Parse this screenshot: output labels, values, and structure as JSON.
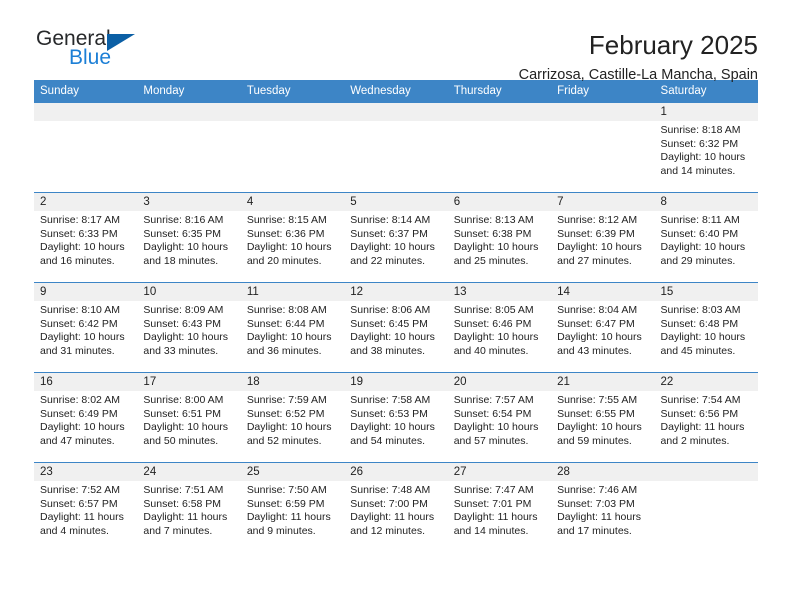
{
  "logo": {
    "text_primary": "General",
    "text_secondary": "Blue",
    "triangle_icon": "triangle-icon",
    "color_primary": "#27292b",
    "color_secondary": "#1c7fd6",
    "color_triangle": "#0b5fa5"
  },
  "header": {
    "title": "February 2025",
    "subtitle": "Carrizosa, Castille-La Mancha, Spain"
  },
  "theme": {
    "header_bg": "#3d85c6",
    "header_text": "#ffffff",
    "daynum_band_bg": "#f0f0f0",
    "cell_border": "#3d85c6",
    "body_text": "#222222"
  },
  "calendar": {
    "weekday_headers": [
      "Sunday",
      "Monday",
      "Tuesday",
      "Wednesday",
      "Thursday",
      "Friday",
      "Saturday"
    ],
    "weeks": [
      [
        {
          "day": "",
          "empty": true
        },
        {
          "day": "",
          "empty": true
        },
        {
          "day": "",
          "empty": true
        },
        {
          "day": "",
          "empty": true
        },
        {
          "day": "",
          "empty": true
        },
        {
          "day": "",
          "empty": true
        },
        {
          "day": "1",
          "sunrise": "Sunrise: 8:18 AM",
          "sunset": "Sunset: 6:32 PM",
          "daylight": "Daylight: 10 hours and 14 minutes."
        }
      ],
      [
        {
          "day": "2",
          "sunrise": "Sunrise: 8:17 AM",
          "sunset": "Sunset: 6:33 PM",
          "daylight": "Daylight: 10 hours and 16 minutes."
        },
        {
          "day": "3",
          "sunrise": "Sunrise: 8:16 AM",
          "sunset": "Sunset: 6:35 PM",
          "daylight": "Daylight: 10 hours and 18 minutes."
        },
        {
          "day": "4",
          "sunrise": "Sunrise: 8:15 AM",
          "sunset": "Sunset: 6:36 PM",
          "daylight": "Daylight: 10 hours and 20 minutes."
        },
        {
          "day": "5",
          "sunrise": "Sunrise: 8:14 AM",
          "sunset": "Sunset: 6:37 PM",
          "daylight": "Daylight: 10 hours and 22 minutes."
        },
        {
          "day": "6",
          "sunrise": "Sunrise: 8:13 AM",
          "sunset": "Sunset: 6:38 PM",
          "daylight": "Daylight: 10 hours and 25 minutes."
        },
        {
          "day": "7",
          "sunrise": "Sunrise: 8:12 AM",
          "sunset": "Sunset: 6:39 PM",
          "daylight": "Daylight: 10 hours and 27 minutes."
        },
        {
          "day": "8",
          "sunrise": "Sunrise: 8:11 AM",
          "sunset": "Sunset: 6:40 PM",
          "daylight": "Daylight: 10 hours and 29 minutes."
        }
      ],
      [
        {
          "day": "9",
          "sunrise": "Sunrise: 8:10 AM",
          "sunset": "Sunset: 6:42 PM",
          "daylight": "Daylight: 10 hours and 31 minutes."
        },
        {
          "day": "10",
          "sunrise": "Sunrise: 8:09 AM",
          "sunset": "Sunset: 6:43 PM",
          "daylight": "Daylight: 10 hours and 33 minutes."
        },
        {
          "day": "11",
          "sunrise": "Sunrise: 8:08 AM",
          "sunset": "Sunset: 6:44 PM",
          "daylight": "Daylight: 10 hours and 36 minutes."
        },
        {
          "day": "12",
          "sunrise": "Sunrise: 8:06 AM",
          "sunset": "Sunset: 6:45 PM",
          "daylight": "Daylight: 10 hours and 38 minutes."
        },
        {
          "day": "13",
          "sunrise": "Sunrise: 8:05 AM",
          "sunset": "Sunset: 6:46 PM",
          "daylight": "Daylight: 10 hours and 40 minutes."
        },
        {
          "day": "14",
          "sunrise": "Sunrise: 8:04 AM",
          "sunset": "Sunset: 6:47 PM",
          "daylight": "Daylight: 10 hours and 43 minutes."
        },
        {
          "day": "15",
          "sunrise": "Sunrise: 8:03 AM",
          "sunset": "Sunset: 6:48 PM",
          "daylight": "Daylight: 10 hours and 45 minutes."
        }
      ],
      [
        {
          "day": "16",
          "sunrise": "Sunrise: 8:02 AM",
          "sunset": "Sunset: 6:49 PM",
          "daylight": "Daylight: 10 hours and 47 minutes."
        },
        {
          "day": "17",
          "sunrise": "Sunrise: 8:00 AM",
          "sunset": "Sunset: 6:51 PM",
          "daylight": "Daylight: 10 hours and 50 minutes."
        },
        {
          "day": "18",
          "sunrise": "Sunrise: 7:59 AM",
          "sunset": "Sunset: 6:52 PM",
          "daylight": "Daylight: 10 hours and 52 minutes."
        },
        {
          "day": "19",
          "sunrise": "Sunrise: 7:58 AM",
          "sunset": "Sunset: 6:53 PM",
          "daylight": "Daylight: 10 hours and 54 minutes."
        },
        {
          "day": "20",
          "sunrise": "Sunrise: 7:57 AM",
          "sunset": "Sunset: 6:54 PM",
          "daylight": "Daylight: 10 hours and 57 minutes."
        },
        {
          "day": "21",
          "sunrise": "Sunrise: 7:55 AM",
          "sunset": "Sunset: 6:55 PM",
          "daylight": "Daylight: 10 hours and 59 minutes."
        },
        {
          "day": "22",
          "sunrise": "Sunrise: 7:54 AM",
          "sunset": "Sunset: 6:56 PM",
          "daylight": "Daylight: 11 hours and 2 minutes."
        }
      ],
      [
        {
          "day": "23",
          "sunrise": "Sunrise: 7:52 AM",
          "sunset": "Sunset: 6:57 PM",
          "daylight": "Daylight: 11 hours and 4 minutes."
        },
        {
          "day": "24",
          "sunrise": "Sunrise: 7:51 AM",
          "sunset": "Sunset: 6:58 PM",
          "daylight": "Daylight: 11 hours and 7 minutes."
        },
        {
          "day": "25",
          "sunrise": "Sunrise: 7:50 AM",
          "sunset": "Sunset: 6:59 PM",
          "daylight": "Daylight: 11 hours and 9 minutes."
        },
        {
          "day": "26",
          "sunrise": "Sunrise: 7:48 AM",
          "sunset": "Sunset: 7:00 PM",
          "daylight": "Daylight: 11 hours and 12 minutes."
        },
        {
          "day": "27",
          "sunrise": "Sunrise: 7:47 AM",
          "sunset": "Sunset: 7:01 PM",
          "daylight": "Daylight: 11 hours and 14 minutes."
        },
        {
          "day": "28",
          "sunrise": "Sunrise: 7:46 AM",
          "sunset": "Sunset: 7:03 PM",
          "daylight": "Daylight: 11 hours and 17 minutes."
        },
        {
          "day": "",
          "empty": true
        }
      ]
    ]
  }
}
